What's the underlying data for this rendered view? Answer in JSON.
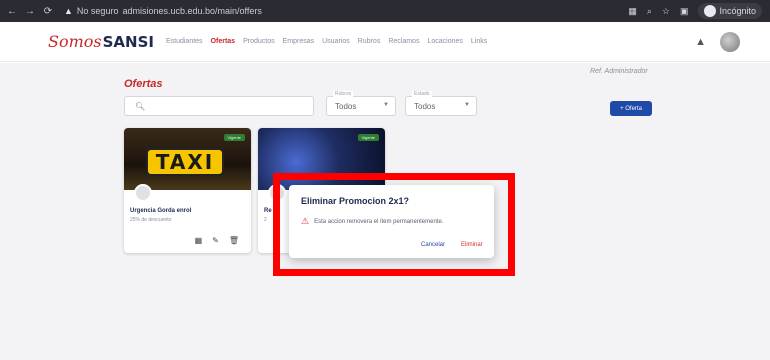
{
  "browser": {
    "nav_icons": [
      "back-icon",
      "forward-icon",
      "reload-icon"
    ],
    "security": "No seguro",
    "url": "admisiones.ucb.edu.bo/main/offers",
    "profile_label": "Incógnito"
  },
  "header": {
    "logo_script": "Somos",
    "logo_bold": "SANSI",
    "nav": [
      "Estudiantes",
      "Ofertas",
      "Productos",
      "Empresas",
      "Usuarios",
      "Rubros",
      "Reclamos",
      "Locaciones",
      "Links"
    ],
    "active_nav": "Ofertas"
  },
  "page": {
    "title": "Ofertas",
    "user_label": "Ref. Administrador",
    "search_placeholder": "",
    "filters": [
      {
        "label": "Rubros",
        "value": "Todos"
      },
      {
        "label": "Estado",
        "value": "Todos"
      }
    ],
    "add_button": "+ Oferta"
  },
  "cards": [
    {
      "name": "Urgencia Gorda enrol",
      "sub": "25% de descuento",
      "badge": "Vigente"
    },
    {
      "name": "Re",
      "sub": "2",
      "badge": "Vigente"
    }
  ],
  "dialog": {
    "title": "Eliminar Promocion 2x1?",
    "message": "Esta accion removera el item permanentemente.",
    "cancel": "Cancelar",
    "delete": "Eliminar"
  }
}
